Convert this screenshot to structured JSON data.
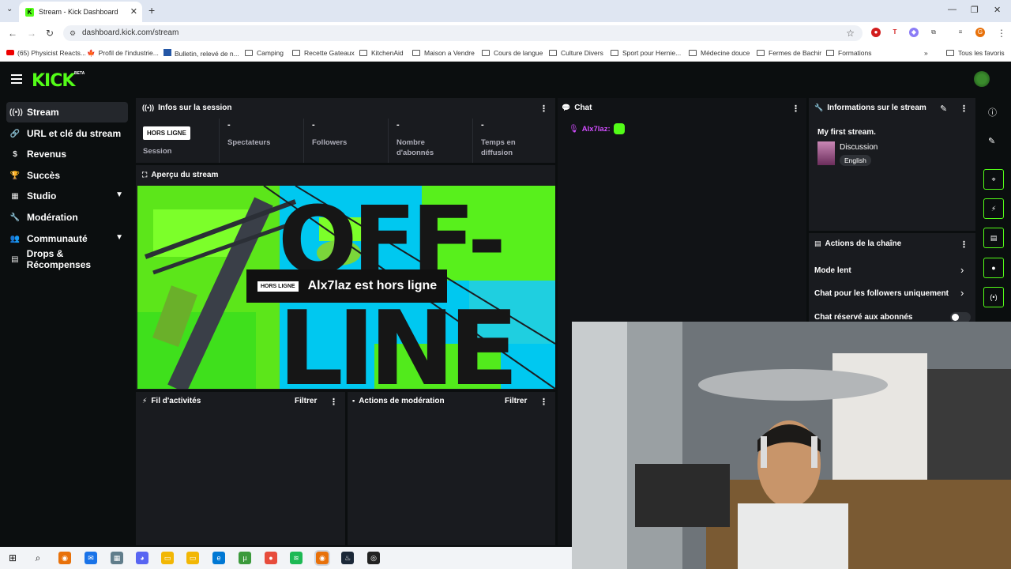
{
  "browser": {
    "tab_title": "Stream - Kick Dashboard",
    "url": "dashboard.kick.com/stream",
    "bookmarks": [
      "(65) Physicist Reacts...",
      "Profil de l'industrie...",
      "Bulletin, relevé de n...",
      "Camping",
      "Recette Gateaux",
      "KitchenAid",
      "Maison a Vendre",
      "Cours de langue",
      "Culture Divers",
      "Sport pour Hernie...",
      "Médecine douce",
      "Fermes de Bachir",
      "Formations"
    ],
    "all_bookmarks": "Tous les favoris",
    "profile_initial": "G"
  },
  "kick": {
    "logo": "KICK",
    "beta": "BETA"
  },
  "sidebar": {
    "items": [
      {
        "label": "Stream",
        "icon": "broadcast-icon"
      },
      {
        "label": "URL et clé du stream",
        "icon": "link-icon"
      },
      {
        "label": "Revenus",
        "icon": "dollar-icon"
      },
      {
        "label": "Succès",
        "icon": "trophy-icon"
      },
      {
        "label": "Studio",
        "icon": "studio-icon"
      },
      {
        "label": "Modération",
        "icon": "wrench-icon"
      },
      {
        "label": "Communauté",
        "icon": "community-icon"
      },
      {
        "label": "Drops & Récompenses",
        "icon": "drops-icon"
      }
    ]
  },
  "session": {
    "title": "Infos sur la session",
    "badge": "HORS LIGNE",
    "session_label": "Session",
    "stats": [
      {
        "value": "-",
        "label": "Spectateurs"
      },
      {
        "value": "-",
        "label": "Followers"
      },
      {
        "value": "-",
        "label": "Nombre d'abonnés"
      },
      {
        "value": "-",
        "label": "Temps en diffusion"
      }
    ]
  },
  "preview": {
    "title": "Aperçu du stream",
    "offline_word_1": "OFF-",
    "offline_word_2": "LINE",
    "offline_badge": "HORS LIGNE",
    "offline_text": "Alx7laz est hors ligne"
  },
  "activity": {
    "title": "Fil d'activités",
    "filter": "Filtrer"
  },
  "modactions": {
    "title": "Actions de modération",
    "filter": "Filtrer"
  },
  "chat": {
    "title": "Chat",
    "username": "Alx7laz:"
  },
  "streaminfo": {
    "title": "Informations sur le stream",
    "stream_title": "My first stream.",
    "category": "Discussion",
    "language": "English"
  },
  "channel_actions": {
    "title": "Actions de la chaîne",
    "rows": [
      "Mode lent",
      "Chat pour les followers uniquement",
      "Chat réservé aux abonnés"
    ]
  },
  "colors": {
    "accent": "#53fc18",
    "panel": "#191b1f",
    "background": "#0b0e0f"
  }
}
